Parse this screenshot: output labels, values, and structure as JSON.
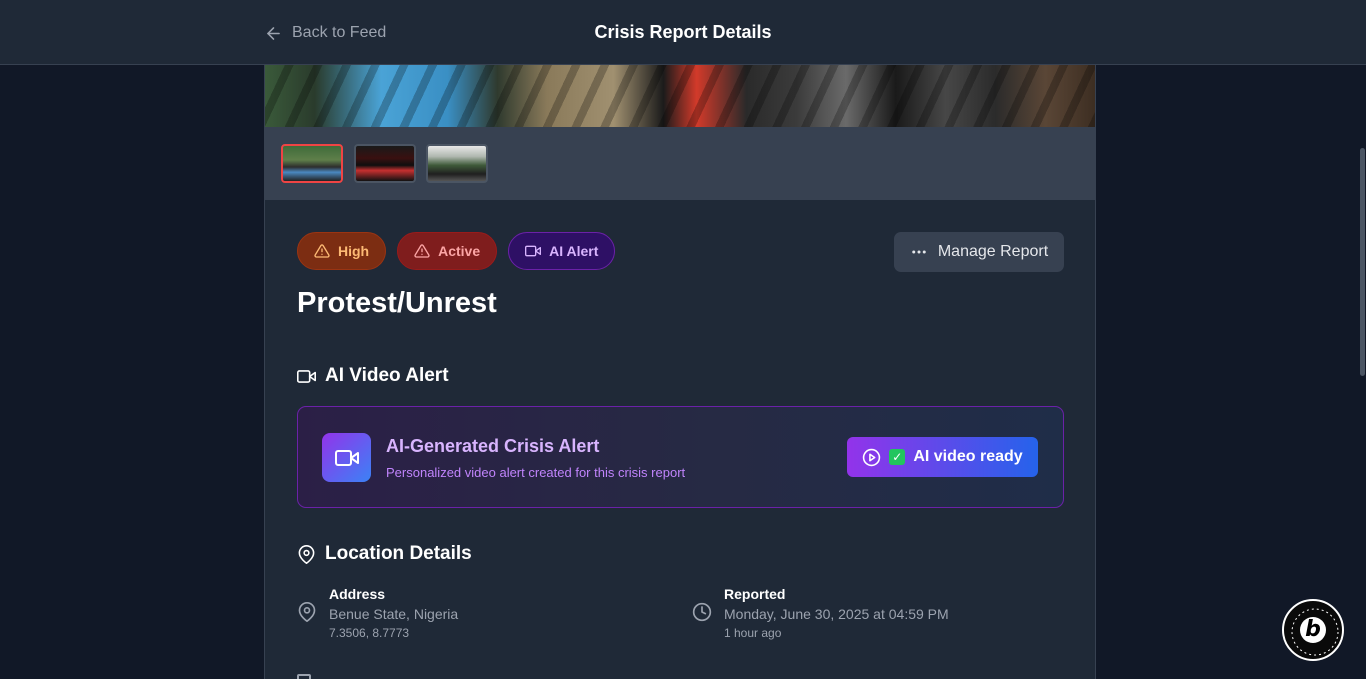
{
  "header": {
    "back_label": "Back to Feed",
    "title": "Crisis Report Details"
  },
  "gallery": {
    "selected_index": 0,
    "thumbnails": [
      "thumbnail-1",
      "thumbnail-2",
      "thumbnail-3"
    ]
  },
  "badges": {
    "severity": "High",
    "status": "Active",
    "ai": "AI Alert"
  },
  "manage_label": "Manage Report",
  "incident_title": "Protest/Unrest",
  "video_section": {
    "heading": "AI Video Alert",
    "card_title": "AI-Generated Crisis Alert",
    "card_subtitle": "Personalized video alert created for this crisis report",
    "button_label": "AI video ready",
    "button_check": "✓"
  },
  "location_section": {
    "heading": "Location Details",
    "address_label": "Address",
    "address_value": "Benue State, Nigeria",
    "coordinates": "7.3506, 8.7773",
    "reported_label": "Reported",
    "reported_value": "Monday, June 30, 2025 at 04:59 PM",
    "reported_relative": "1 hour ago"
  },
  "colors": {
    "page_bg": "#111827",
    "card_bg": "#1f2937",
    "high": "#fdba74",
    "active": "#fca5a5",
    "ai": "#d8b4fe",
    "accent_purple": "#9333ea",
    "accent_blue": "#2563eb",
    "selected_thumb": "#ef4444"
  },
  "icons": {
    "back": "arrow-left-icon",
    "warning": "alert-triangle-icon",
    "video": "video-icon",
    "more": "more-horizontal-icon",
    "play": "play-circle-icon",
    "location": "map-pin-icon",
    "clock": "clock-icon"
  }
}
